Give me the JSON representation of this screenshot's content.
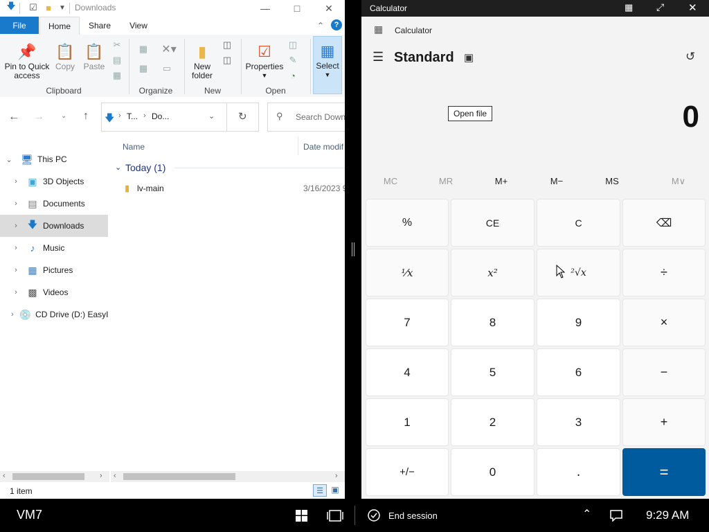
{
  "explorer": {
    "title": "Downloads",
    "tabs": [
      "File",
      "Home",
      "Share",
      "View"
    ],
    "ribbon": {
      "pin_label_1": "Pin to Quick",
      "pin_label_2": "access",
      "copy_label": "Copy",
      "paste_label": "Paste",
      "clipboard_group": "Clipboard",
      "organize_group": "Organize",
      "new_folder_1": "New",
      "new_folder_2": "folder",
      "new_group": "New",
      "properties_label": "Properties",
      "open_group": "Open",
      "select_label": "Select"
    },
    "address": {
      "seg1": "T...",
      "seg2": "Do..."
    },
    "search_placeholder": "Search Downl",
    "columns": {
      "name": "Name",
      "date": "Date modif"
    },
    "group_header": "Today (1)",
    "files": [
      {
        "name": "lv-main",
        "date": "3/16/2023 9"
      }
    ],
    "tree": [
      {
        "label": "This PC",
        "icon": "pc-icon"
      },
      {
        "label": "3D Objects",
        "icon": "cube-icon"
      },
      {
        "label": "Documents",
        "icon": "document-icon"
      },
      {
        "label": "Downloads",
        "icon": "download-icon"
      },
      {
        "label": "Music",
        "icon": "music-icon"
      },
      {
        "label": "Pictures",
        "icon": "picture-icon"
      },
      {
        "label": "Videos",
        "icon": "video-icon"
      },
      {
        "label": "CD Drive (D:) EasyI",
        "icon": "cd-drive-icon"
      }
    ],
    "status": "1 item"
  },
  "calculator": {
    "window_title": "Calculator",
    "app_title": "Calculator",
    "mode": "Standard",
    "tooltip": "Open file",
    "display": "0",
    "memory": [
      "MC",
      "MR",
      "M+",
      "M−",
      "MS",
      "M∨"
    ],
    "keys": [
      [
        "%",
        "CE",
        "C",
        "⌫"
      ],
      [
        "⅟x",
        "x²",
        "²√x",
        "÷"
      ],
      [
        "7",
        "8",
        "9",
        "×"
      ],
      [
        "4",
        "5",
        "6",
        "−"
      ],
      [
        "1",
        "2",
        "3",
        "+"
      ],
      [
        "+/−",
        "0",
        ".",
        "="
      ]
    ]
  },
  "taskbar": {
    "vm_label": "VM7",
    "end_session": "End session",
    "time": "9:29 AM"
  }
}
